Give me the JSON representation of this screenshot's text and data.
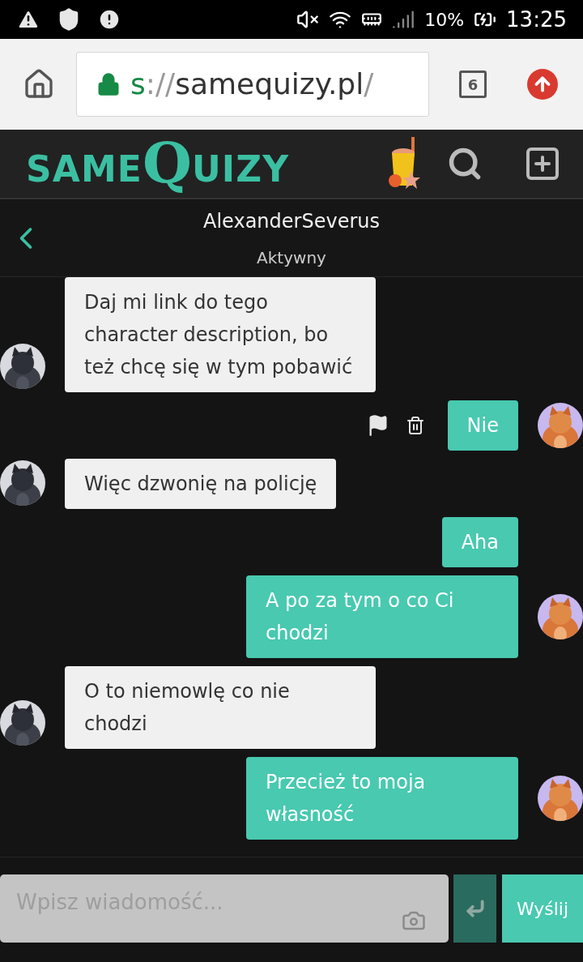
{
  "status_bar": {
    "battery": "10%",
    "time": "13:25"
  },
  "browser": {
    "url_scheme": "s",
    "url_separator": "://",
    "url_host": "samequizy.pl",
    "url_path": "/",
    "tab_count": "6"
  },
  "site_header": {
    "logo": {
      "small": "SAME",
      "big": "Q",
      "rest": "UIZY"
    }
  },
  "chat_header": {
    "name": "AlexanderSeverus",
    "status": "Aktywny"
  },
  "messages": [
    {
      "kind": "received",
      "text": "Daj mi link do tego character description, bo też chcę się w tym pobawić",
      "avatar": true,
      "actions": false
    },
    {
      "kind": "sent",
      "text": "Nie",
      "avatar": true,
      "actions": true
    },
    {
      "kind": "received",
      "text": "Więc dzwonię na policję",
      "avatar": true,
      "actions": false
    },
    {
      "kind": "sent",
      "text": "Aha",
      "avatar": false,
      "actions": false
    },
    {
      "kind": "sent",
      "text": "A po za tym o co Ci chodzi",
      "avatar": true,
      "actions": false
    },
    {
      "kind": "received",
      "text": "O to niemowlę co nie chodzi",
      "avatar": true,
      "actions": false
    },
    {
      "kind": "sent",
      "text": "Przecież to moja własność",
      "avatar": true,
      "actions": false
    }
  ],
  "composer": {
    "placeholder": "Wpisz wiadomość...",
    "send": "Wyślij"
  }
}
